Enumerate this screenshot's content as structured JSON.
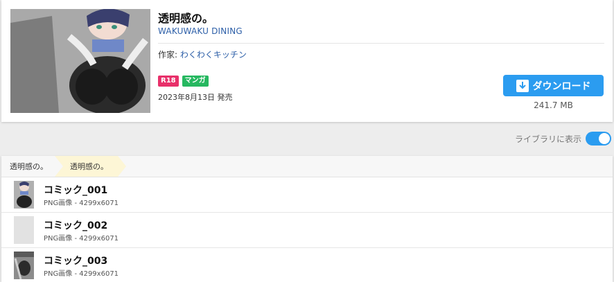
{
  "work": {
    "title": "透明感の。",
    "circle": "WAKUWAKU DINING",
    "author_label": "作家:",
    "author_name": "わくわくキッチン",
    "tags": [
      "R18",
      "マンガ"
    ],
    "release": "2023年8月13日 発売",
    "download_label": "ダウンロード",
    "file_size": "241.7 MB"
  },
  "library": {
    "label": "ライブラリに表示",
    "enabled": true
  },
  "breadcrumb": [
    "透明感の。",
    "透明感の。"
  ],
  "files": [
    {
      "name": "コミック_001",
      "meta": "PNG画像 - 4299x6071",
      "thumb": "color"
    },
    {
      "name": "コミック_002",
      "meta": "PNG画像 - 4299x6071",
      "thumb": "blank"
    },
    {
      "name": "コミック_003",
      "meta": "PNG画像 - 4299x6071",
      "thumb": "mono"
    }
  ],
  "colors": {
    "accent": "#2b9cf0",
    "tag_r18": "#e8306a",
    "tag_manga": "#26b860",
    "link": "#2d5fa8",
    "breadcrumb_active": "#fdf6d6"
  }
}
